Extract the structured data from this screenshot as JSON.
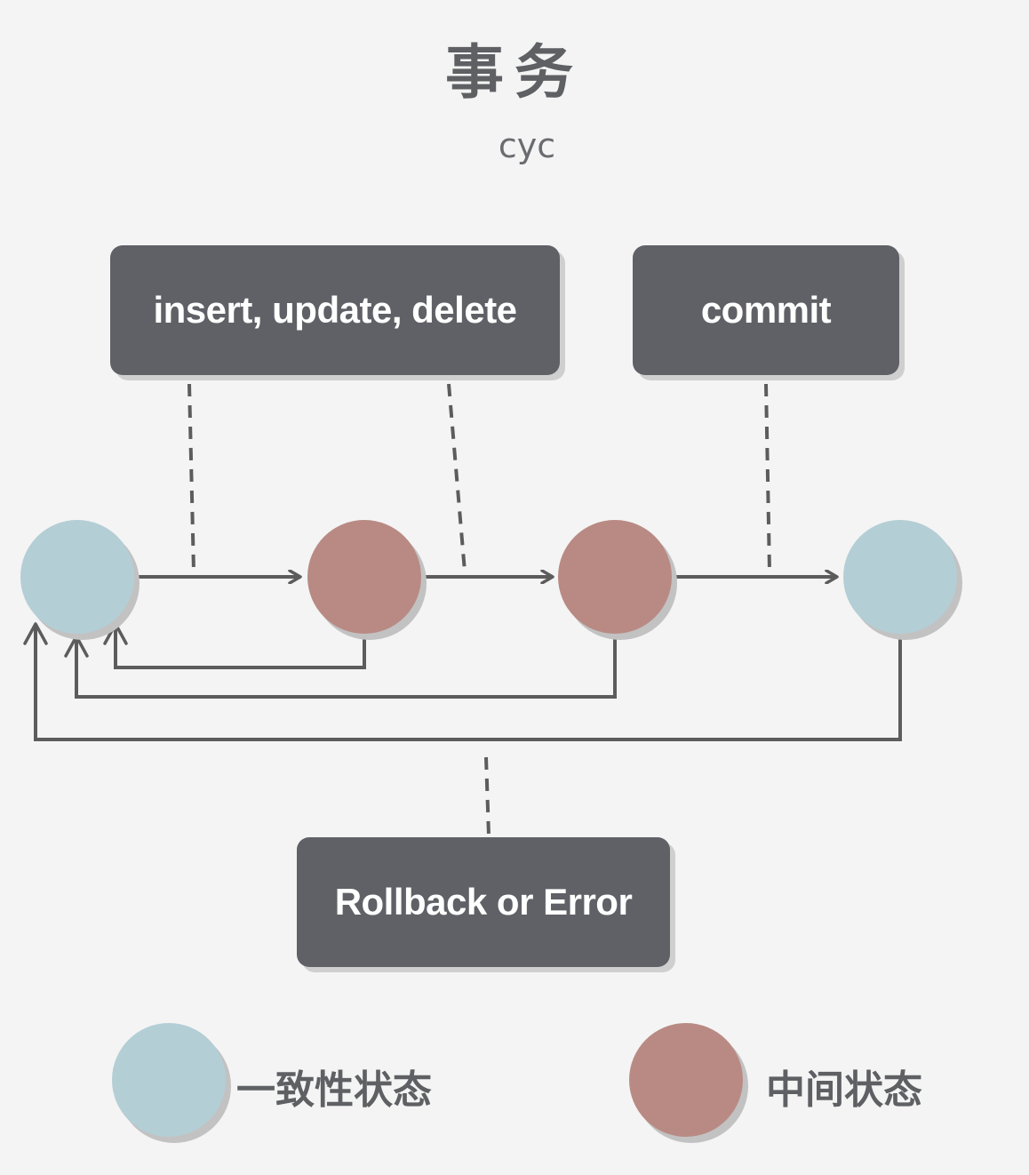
{
  "title": "事务",
  "subtitle": "cyc",
  "operations_box": {
    "label": "insert, update, delete"
  },
  "commit_box": {
    "label": "commit"
  },
  "rollback_box": {
    "label": "Rollback or Error"
  },
  "legend": {
    "consistent": {
      "label": "一致性状态",
      "color": "#b4ced5"
    },
    "intermediate": {
      "label": "中间状态",
      "color": "#b98a84"
    }
  },
  "colors": {
    "background": "#f4f4f4",
    "box": "#606166",
    "line": "#5c5c5c",
    "shadow": "#cfcfcf"
  }
}
